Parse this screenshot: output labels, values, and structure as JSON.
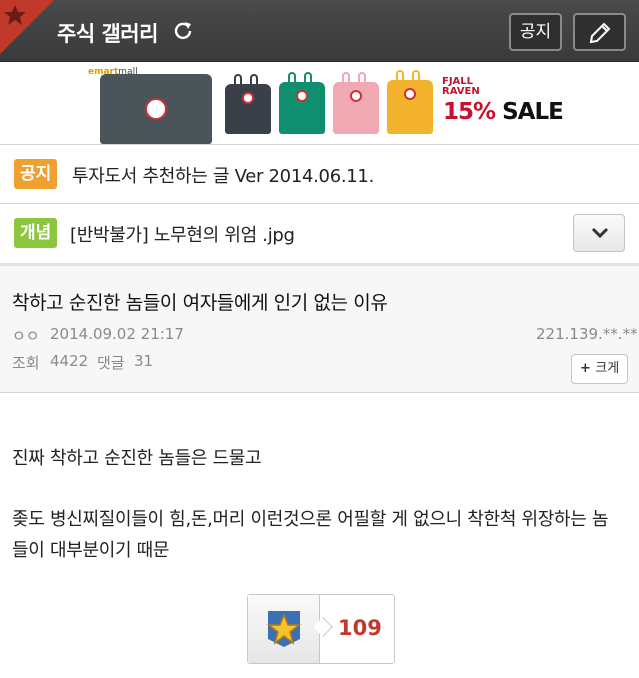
{
  "header": {
    "title": "주식 갤러리",
    "notice_button": "공지"
  },
  "banner": {
    "store": "emart",
    "store_suffix": "mall",
    "brand_line1": "FJALL",
    "brand_line2": "RAVEN",
    "sale_percent": "15%",
    "sale_word": "SALE",
    "bag_colors": [
      "#4b5459",
      "#3a4048",
      "#0f8f6f",
      "#f0a8b2",
      "#f2b22c"
    ]
  },
  "notices": [
    {
      "tag": "공지",
      "text": "투자도서 추천하는 글 Ver 2014.06.11."
    },
    {
      "tag": "개념",
      "text": "[반박불가] 노무현의 위엄 .jpg"
    }
  ],
  "post": {
    "title": "착하고 순진한 놈들이 여자들에게 인기 없는 이유",
    "author": "ㅇㅇ",
    "date": "2014.09.02 21:17",
    "ip": "221.139.**.**",
    "views_label": "조회",
    "views": "4422",
    "comments_label": "댓글",
    "comments": "31",
    "bigger_label": "크게",
    "body_line1": "진짜 착하고 순진한 놈들은 드물고",
    "body_line2": "좆도 병신찌질이들이 힘,돈,머리 이런것으론 어필할 게 없으니 착한척 위장하는 놈",
    "body_line3": "들이 대부분이기 때문",
    "recommend_count": "109"
  },
  "colors": {
    "topbar": "#3f3f3f",
    "tag_notice": "#f0a030",
    "tag_concept": "#8cc63f",
    "recommend": "#c0392b"
  }
}
